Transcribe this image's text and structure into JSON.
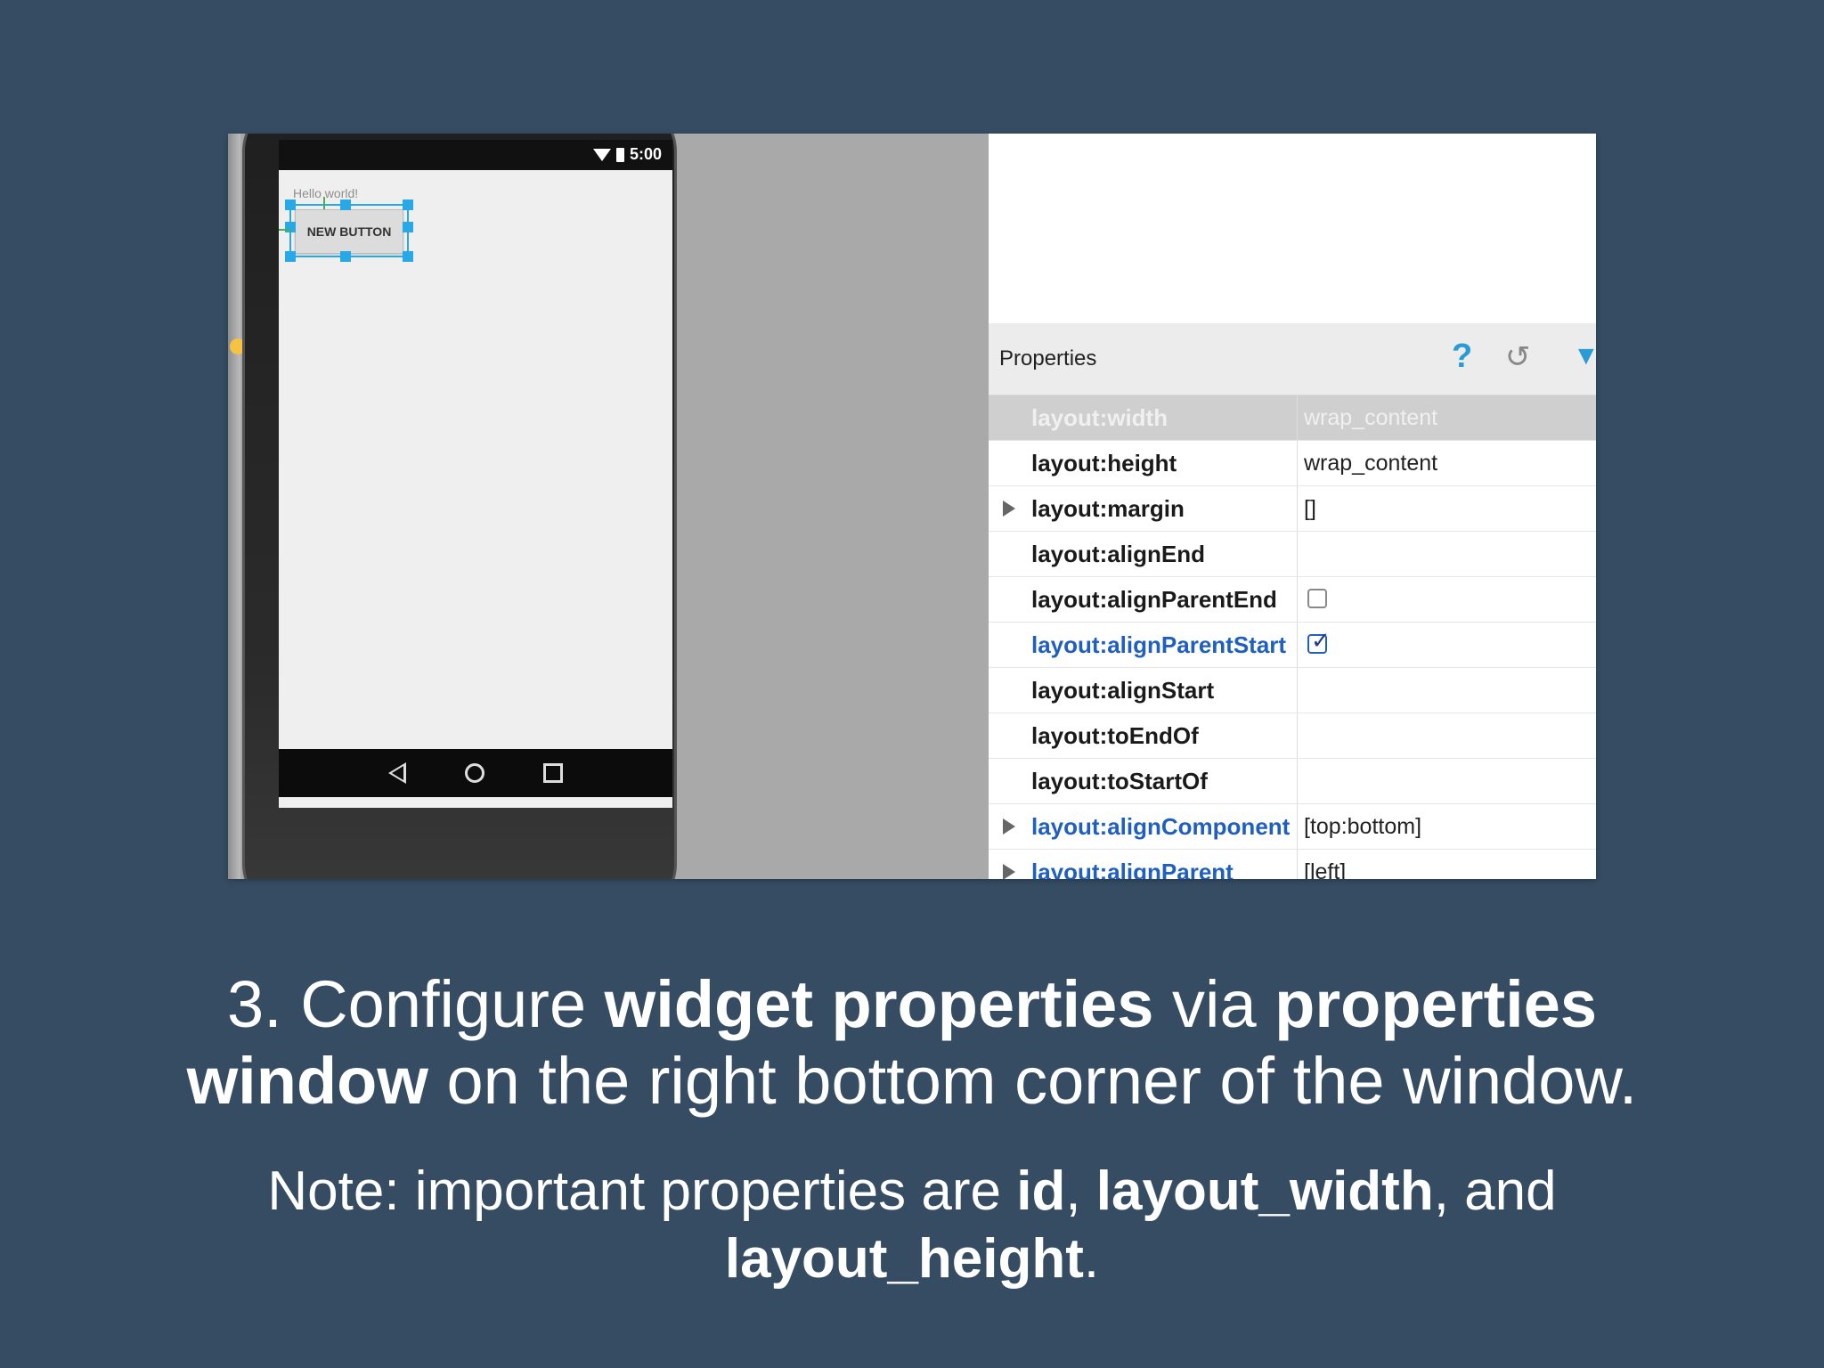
{
  "phone": {
    "status_time": "5:00",
    "hello_text": "Hello world!",
    "button_label": "NEW BUTTON"
  },
  "properties": {
    "title": "Properties",
    "help_icon": "?",
    "undo_icon": "↺",
    "filter_icon": "▼",
    "rows": [
      {
        "key": "layout:width",
        "value": "wrap_content"
      },
      {
        "key": "layout:height",
        "value": "wrap_content"
      },
      {
        "key": "layout:margin",
        "value": "[]"
      },
      {
        "key": "layout:alignEnd",
        "value": ""
      },
      {
        "key": "layout:alignParentEnd",
        "value": ""
      },
      {
        "key": "layout:alignParentStart",
        "value": ""
      },
      {
        "key": "layout:alignStart",
        "value": ""
      },
      {
        "key": "layout:toEndOf",
        "value": ""
      },
      {
        "key": "layout:toStartOf",
        "value": ""
      },
      {
        "key": "layout:alignComponent",
        "value": "[top:bottom]"
      },
      {
        "key": "layout:alignParent",
        "value": "[left]"
      }
    ]
  },
  "caption": {
    "p1": "3. Configure ",
    "b1": "widget properties",
    "p2": " via ",
    "b2": "properties",
    "b3": "window",
    "p3": " on the right bottom corner of the window."
  },
  "note": {
    "p1": "Note: important properties are ",
    "b1": "id",
    "p2": ", ",
    "b2": "layout_width",
    "p3": ", and",
    "b3": "layout_height",
    "p4": "."
  },
  "colors": {
    "background": "#354c63",
    "accent_blue": "#1f5fbf",
    "selection_blue": "#29a8e8"
  }
}
